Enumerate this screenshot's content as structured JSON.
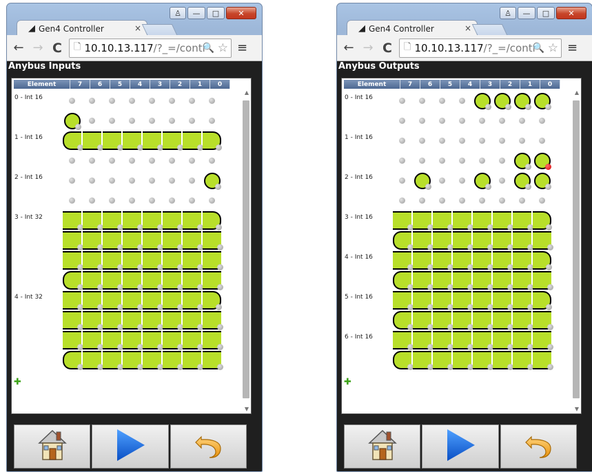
{
  "browser": {
    "tab_title": "Gen4 Controller",
    "tab_close": "×",
    "url_host": "10.10.13.117",
    "url_path": "/?_=/contr",
    "back_glyph": "←",
    "forward_glyph": "→",
    "reload_glyph": "C",
    "page_glyph": "🗋",
    "zoom_glyph": "🔍",
    "star_glyph": "☆",
    "menu_glyph": "≡",
    "win_min": "—",
    "win_max": "□",
    "win_close": "✕",
    "win_user": "♙"
  },
  "header_cols": [
    "Element",
    "7",
    "6",
    "5",
    "4",
    "3",
    "2",
    "1",
    "0"
  ],
  "add_glyph": "✚",
  "scroll_up": "▲",
  "scroll_down": "▼",
  "colors": {
    "on": "#b8df2a",
    "header": "#5a75a0",
    "off": "#a8a8a8",
    "alert": "#d50000"
  },
  "icons": [
    "home-icon",
    "play-icon",
    "undo-icon"
  ],
  "inputs": {
    "title": "Anybus Inputs",
    "labels": [
      "0 - Int 16",
      "1 - Int 16",
      "2 - Int 16",
      "3 - Int 32",
      "4 - Int 32"
    ],
    "label_rows": [
      0,
      2,
      4,
      6,
      10
    ],
    "rows": [
      "--------",
      "c-------",
      "LBBBBBBR",
      "--------",
      "-------c",
      "--------",
      "BBBBBBBR",
      "BBBBBBBB",
      "BBBBBBBB",
      "LBBBBBBB",
      "BBBBBBBR",
      "BBBBBBBB",
      "BBBBBBBB",
      "LBBBBBBB"
    ]
  },
  "outputs": {
    "title": "Anybus Outputs",
    "labels": [
      "0 - Int 16",
      "1 - Int 16",
      "2 - Int 16",
      "3 - Int 16",
      "4 - Int 16",
      "5 - Int 16",
      "6 - Int 16"
    ],
    "label_rows": [
      0,
      2,
      4,
      6,
      8,
      10,
      12
    ],
    "rows": [
      "----cccc",
      "--------",
      "--------",
      "------cx",
      "-c--c-cc",
      "--------",
      "BBBBBBBR",
      "LBBBBBBB",
      "BBBBBBBR",
      "LBBBBBBB",
      "BBBBBBBR",
      "LBBBBBBB",
      "BBBBBBBB",
      "LBBBBBBB"
    ]
  }
}
